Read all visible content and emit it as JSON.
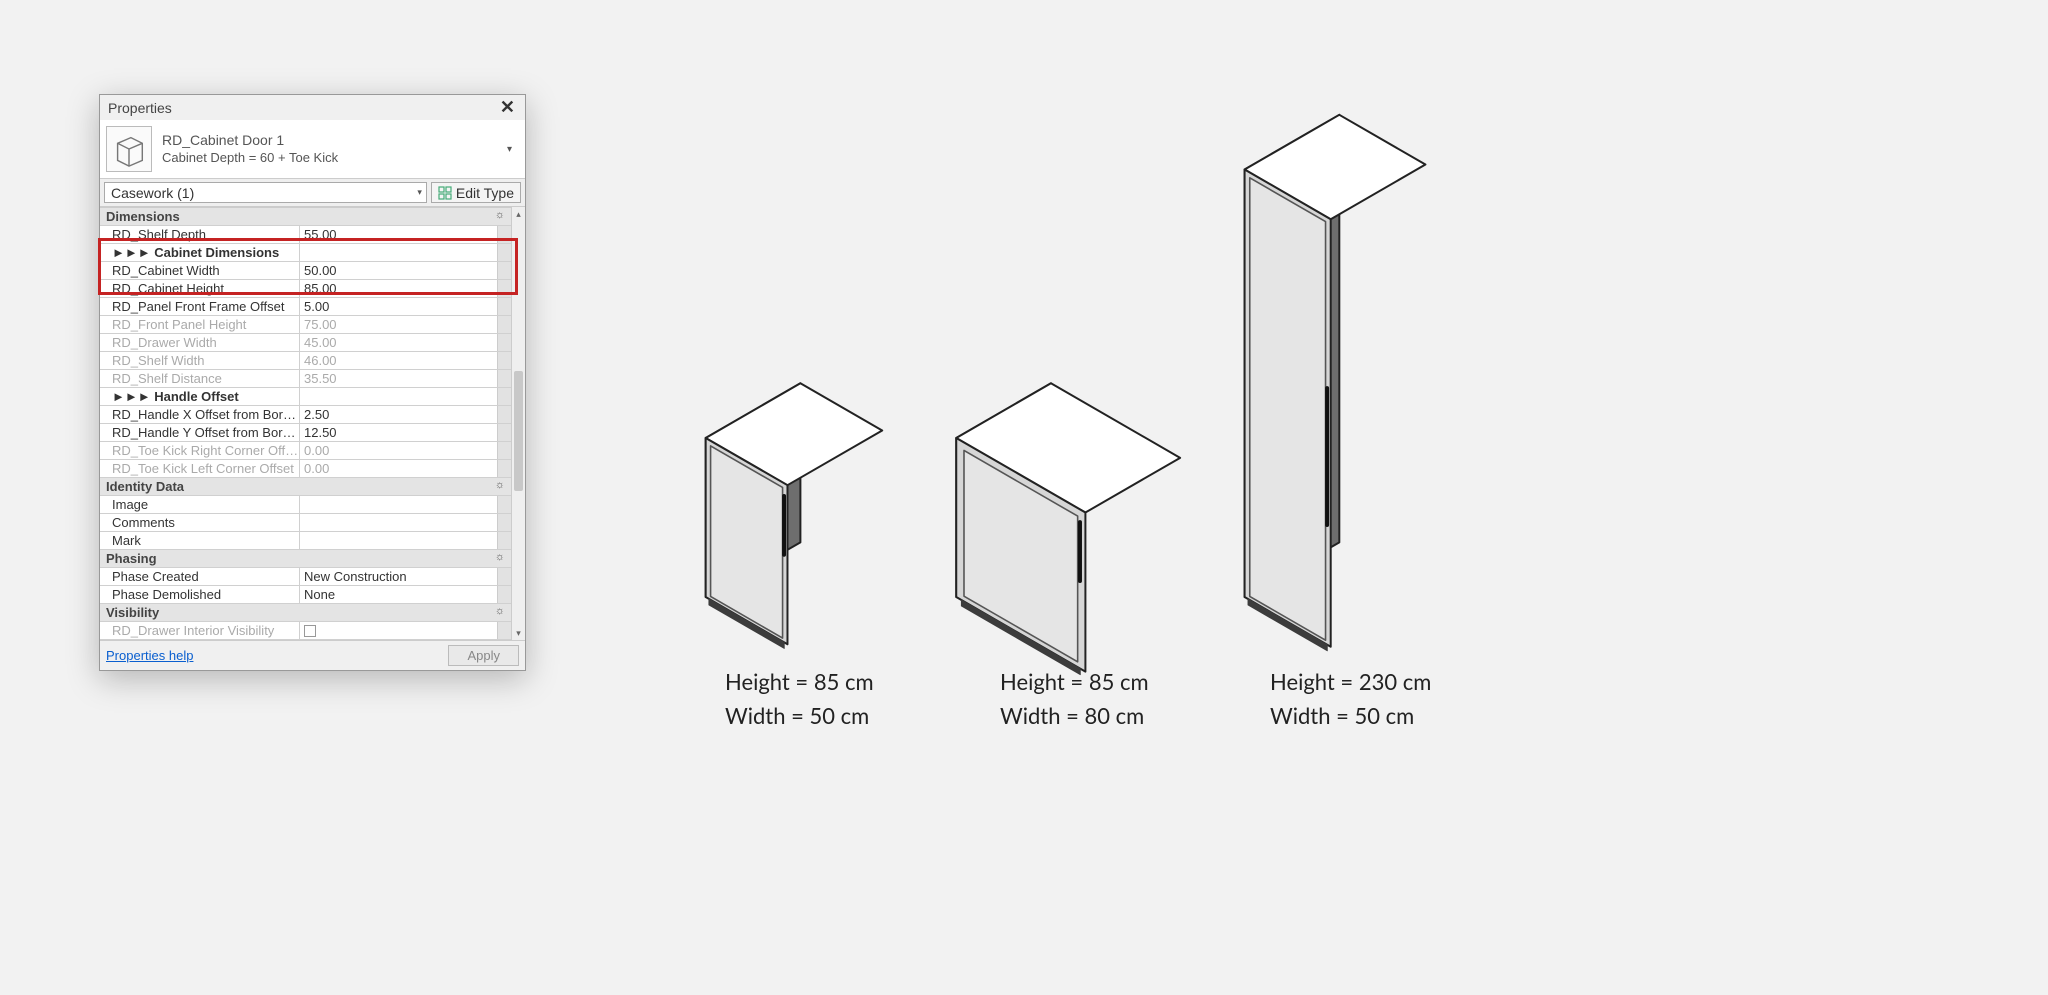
{
  "panel": {
    "title": "Properties",
    "type_name": "RD_Cabinet Door 1",
    "type_sub": "Cabinet Depth = 60 + Toe Kick",
    "selector": "Casework (1)",
    "edit_type_label": "Edit Type",
    "help_link": "Properties help",
    "apply_label": "Apply"
  },
  "groups": {
    "dimensions": "Dimensions",
    "identity": "Identity Data",
    "phasing": "Phasing",
    "visibility": "Visibility"
  },
  "rows": [
    {
      "label": "RD_Shelf Depth",
      "value": "55.00",
      "editable": true
    },
    {
      "label": "►►► Cabinet Dimensions",
      "value": "",
      "editable": true,
      "bold": true
    },
    {
      "label": "RD_Cabinet Width",
      "value": "50.00",
      "editable": true
    },
    {
      "label": "RD_Cabinet Height",
      "value": "85.00",
      "editable": true
    },
    {
      "label": "RD_Panel Front Frame Offset",
      "value": "5.00",
      "editable": true
    },
    {
      "label": "RD_Front Panel Height",
      "value": "75.00",
      "editable": false
    },
    {
      "label": "RD_Drawer Width",
      "value": "45.00",
      "editable": false
    },
    {
      "label": "RD_Shelf Width",
      "value": "46.00",
      "editable": false
    },
    {
      "label": "RD_Shelf Distance",
      "value": "35.50",
      "editable": false
    },
    {
      "label": "►►► Handle Offset",
      "value": "",
      "editable": true,
      "bold": true
    },
    {
      "label": "RD_Handle X Offset from Border",
      "value": "2.50",
      "editable": true
    },
    {
      "label": "RD_Handle Y Offset from Border",
      "value": "12.50",
      "editable": true
    },
    {
      "label": "RD_Toe Kick Right Corner Offset",
      "value": "0.00",
      "editable": false
    },
    {
      "label": "RD_Toe Kick Left Corner Offset",
      "value": "0.00",
      "editable": false
    }
  ],
  "identity_rows": [
    {
      "label": "Image",
      "value": ""
    },
    {
      "label": "Comments",
      "value": ""
    },
    {
      "label": "Mark",
      "value": ""
    }
  ],
  "phasing_rows": [
    {
      "label": "Phase Created",
      "value": "New Construction"
    },
    {
      "label": "Phase Demolished",
      "value": "None"
    }
  ],
  "visibility_rows": [
    {
      "label": "RD_Drawer Interior Visibility",
      "checkbox": true,
      "editable": false
    }
  ],
  "cabinets": [
    {
      "height_label": "Height = 85 cm",
      "width_label": "Width = 50 cm"
    },
    {
      "height_label": "Height = 85 cm",
      "width_label": "Width = 80 cm"
    },
    {
      "height_label": "Height = 230 cm",
      "width_label": "Width = 50 cm"
    }
  ]
}
